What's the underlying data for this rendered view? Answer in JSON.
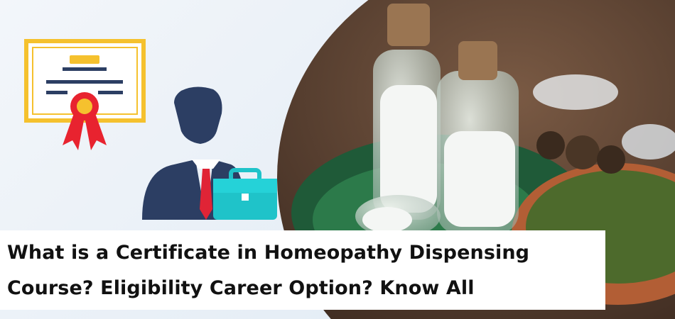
{
  "caption": {
    "line1": "What is a Certificate in Homeopathy Dispensing",
    "line2": "Course? Eligibility Career Option? Know All"
  },
  "icons": {
    "certificate": "certificate-icon",
    "person": "businessman-icon",
    "briefcase": "briefcase-icon"
  },
  "colors": {
    "certificate_border": "#f5c12e",
    "ribbon": "#e8232f",
    "person": "#2c3e63",
    "tie": "#e02436",
    "briefcase": "#1fc3c9"
  }
}
